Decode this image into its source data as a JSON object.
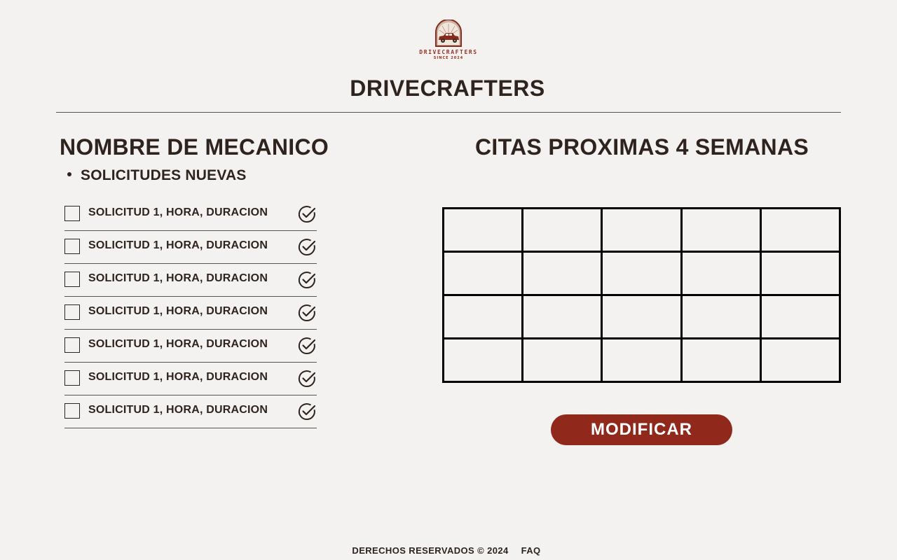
{
  "brand": {
    "logo_text": "DRIVECRAFTERS",
    "logo_tagline": "SINCE 2024",
    "site_title": "DRIVECRAFTERS",
    "accent_color": "#90291b"
  },
  "mechanic": {
    "name": "NOMBRE DE MECANICO",
    "section_label": "SOLICITUDES NUEVAS"
  },
  "requests": [
    {
      "label": "SOLICITUD 1, HORA, DURACION",
      "checked": false
    },
    {
      "label": "SOLICITUD 1, HORA, DURACION",
      "checked": false
    },
    {
      "label": "SOLICITUD 1, HORA, DURACION",
      "checked": false
    },
    {
      "label": "SOLICITUD 1, HORA, DURACION",
      "checked": false
    },
    {
      "label": "SOLICITUD 1, HORA, DURACION",
      "checked": false
    },
    {
      "label": "SOLICITUD 1, HORA, DURACION",
      "checked": false
    },
    {
      "label": "SOLICITUD 1, HORA, DURACION",
      "checked": false
    }
  ],
  "icons": {
    "accept": "check-circle-icon",
    "select": "checkbox-icon",
    "logo": "classic-car-icon"
  },
  "calendar": {
    "title": "CITAS PROXIMAS 4 SEMANAS",
    "weeks": 4,
    "days": 5
  },
  "actions": {
    "modify_label": "MODIFICAR"
  },
  "footer": {
    "rights": "DERECHOS RESERVADOS © 2024",
    "faq": "FAQ"
  }
}
